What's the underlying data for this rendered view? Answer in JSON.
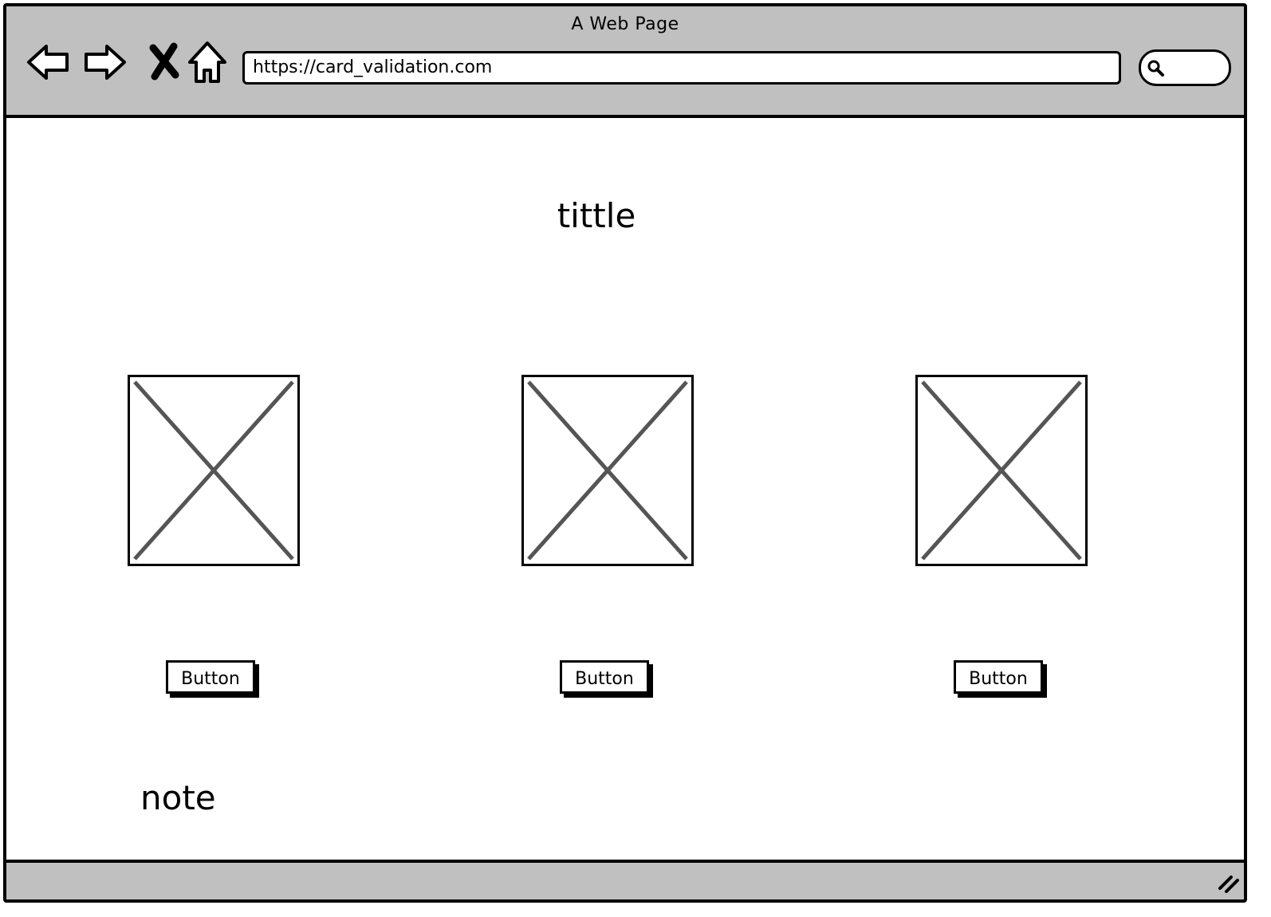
{
  "window": {
    "title": "A Web Page"
  },
  "toolbar": {
    "back_icon": "back-arrow-icon",
    "forward_icon": "forward-arrow-icon",
    "stop_icon": "close-x-icon",
    "home_icon": "home-icon",
    "url": "https://card_validation.com",
    "search_icon": "search-icon"
  },
  "main": {
    "title": "tittle",
    "cards": [
      {
        "image": "image-placeholder",
        "button_label": "Button"
      },
      {
        "image": "image-placeholder",
        "button_label": "Button"
      },
      {
        "image": "image-placeholder",
        "button_label": "Button"
      }
    ],
    "note": "note"
  },
  "statusbar": {
    "resize_icon": "resize-grip-icon"
  },
  "colors": {
    "chrome": "#c0c0c0",
    "border": "#000000",
    "placeholder_cross": "#555555",
    "background": "#ffffff"
  }
}
